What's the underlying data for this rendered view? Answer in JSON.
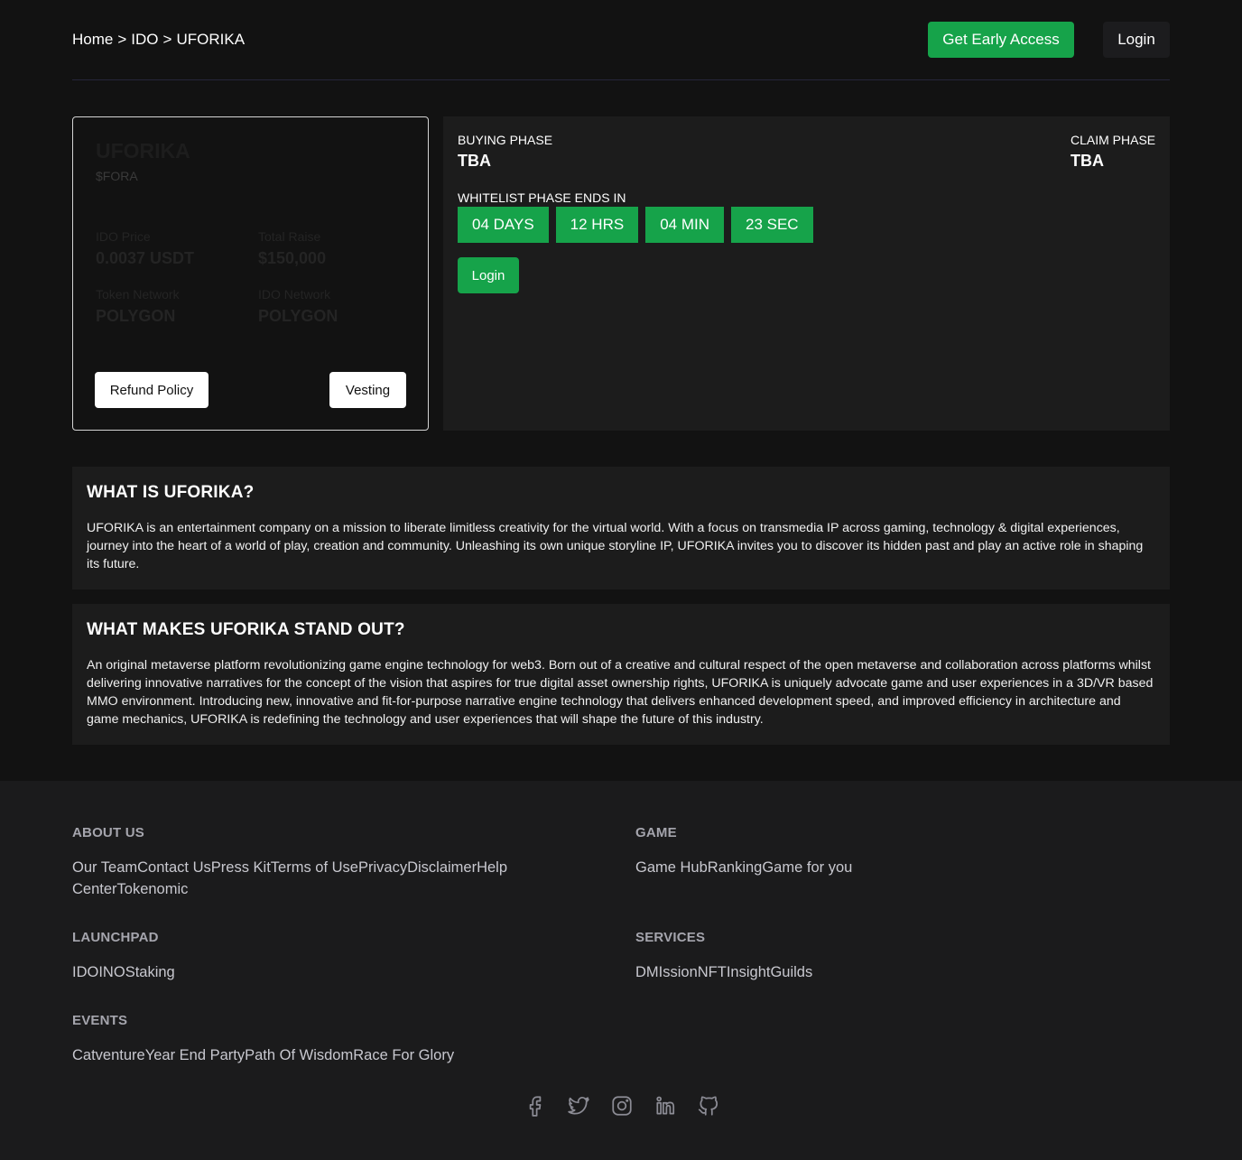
{
  "header": {
    "breadcrumb": [
      "Home",
      "IDO",
      "UFORIKA"
    ],
    "separator": ">",
    "early_access_label": "Get Early Access",
    "login_label": "Login"
  },
  "token": {
    "name": "UFORIKA",
    "symbol": "$FORA",
    "stats": [
      {
        "label": "IDO Price",
        "value": "0.0037 USDT"
      },
      {
        "label": "Total Raise",
        "value": "$150,000"
      },
      {
        "label": "Token Network",
        "value": "POLYGON"
      },
      {
        "label": "IDO Network",
        "value": "POLYGON"
      }
    ],
    "refund_label": "Refund Policy",
    "vesting_label": "Vesting"
  },
  "phase": {
    "buying_label": "BUYING PHASE",
    "buying_value": "TBA",
    "claim_label": "CLAIM PHASE",
    "claim_value": "TBA",
    "whitelist_label": "WHITELIST PHASE ENDS IN",
    "countdown": [
      "04 DAYS",
      "12 HRS",
      "04 MIN",
      "23 SEC"
    ],
    "login_label": "Login"
  },
  "sections": [
    {
      "title": "WHAT IS UFORIKA?",
      "body": "UFORIKA is an entertainment company on a mission to liberate limitless creativity for the virtual world. With a focus on transmedia IP across gaming, technology & digital experiences, journey into the heart of a world of play, creation and community. Unleashing its own unique storyline IP, UFORIKA invites you to discover its hidden past and play an active role in shaping its future."
    },
    {
      "title": "WHAT MAKES UFORIKA STAND OUT?",
      "body": "An original metaverse platform revolutionizing game engine technology for web3. Born out of a creative and cultural respect of the open metaverse and collaboration across platforms whilst delivering innovative narratives for the concept of the vision that aspires for true digital asset ownership rights, UFORIKA is uniquely advocate game and user experiences in a 3D/VR based MMO environment. Introducing new, innovative and fit-for-purpose narrative engine technology that delivers enhanced development speed, and improved efficiency in architecture and game mechanics, UFORIKA is redefining the technology and user experiences that will shape the future of this industry."
    }
  ],
  "footer": {
    "about": {
      "title": "ABOUT US",
      "links": [
        "Our Team",
        "Contact Us",
        "Press Kit",
        "Terms of Use",
        "Privacy",
        "Disclaimer",
        "Help Center",
        "Tokenomic"
      ]
    },
    "game": {
      "title": "GAME",
      "links": [
        "Game Hub",
        "Ranking",
        "Game for you"
      ]
    },
    "launchpad": {
      "title": "LAUNCHPAD",
      "links": [
        "IDO",
        "INO",
        "Staking"
      ]
    },
    "services": {
      "title": "SERVICES",
      "links": [
        "DMIssion",
        "NFTInsight",
        "Guilds"
      ]
    },
    "events": {
      "title": "EVENTS",
      "links": [
        "Catventure",
        "Year End Party",
        "Path Of Wisdom",
        "Race For Glory"
      ]
    },
    "socials": [
      "facebook-icon",
      "twitter-icon",
      "instagram-icon",
      "linkedin-icon",
      "github-icon"
    ],
    "icon_color": "#8c8c95"
  },
  "colors": {
    "accent": "#16a34a",
    "background": "#121212",
    "panel": "#1c1c1c"
  }
}
